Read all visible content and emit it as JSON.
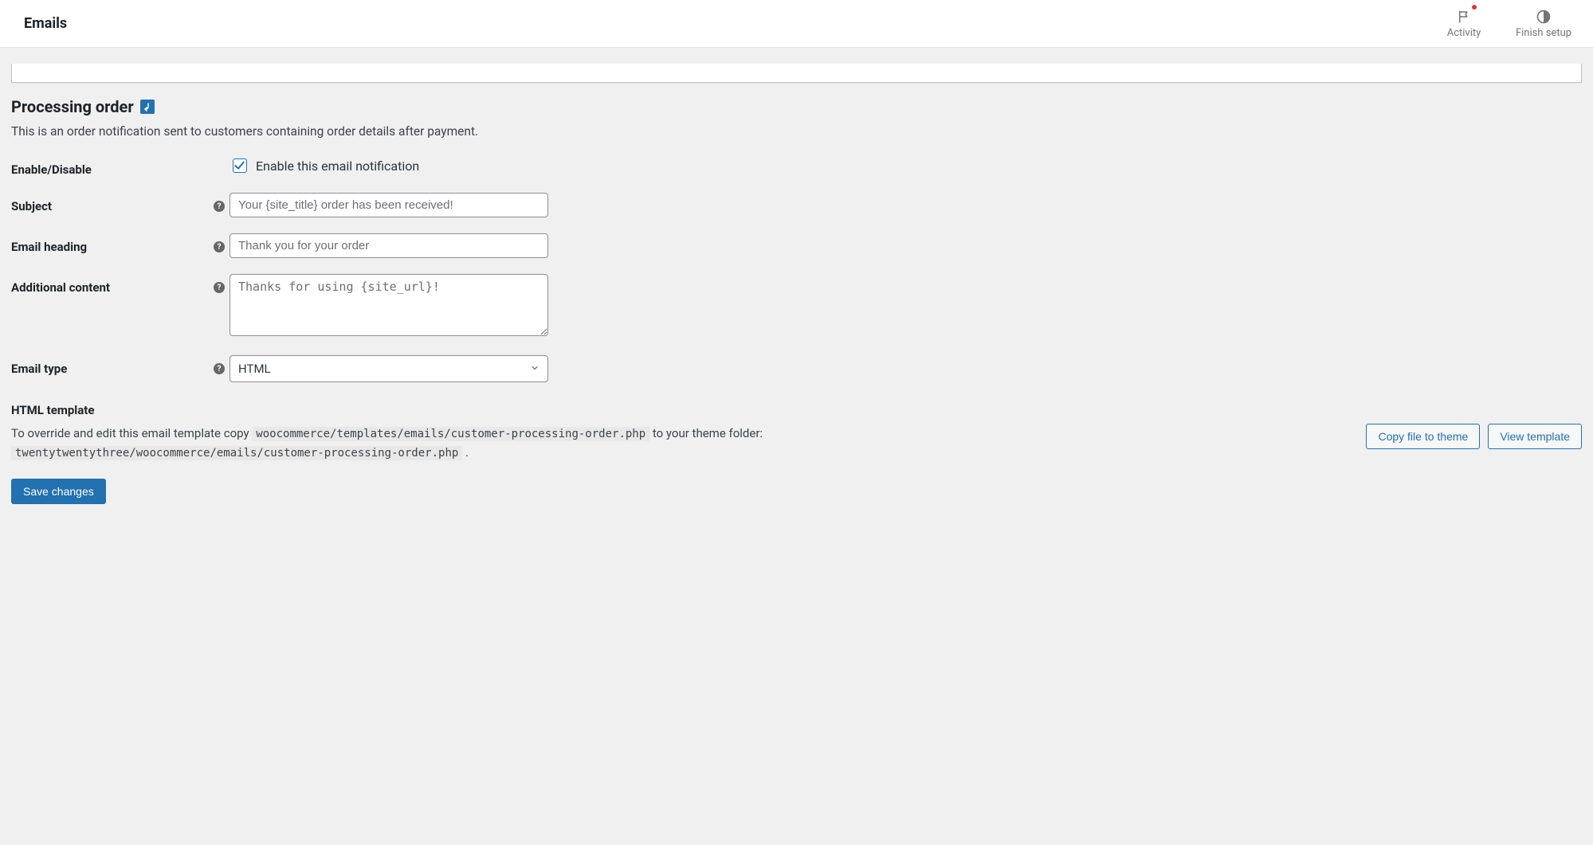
{
  "topbar": {
    "title": "Emails",
    "activity_label": "Activity",
    "finish_setup_label": "Finish setup"
  },
  "section": {
    "title": "Processing order",
    "description": "This is an order notification sent to customers containing order details after payment."
  },
  "form": {
    "enable": {
      "label": "Enable/Disable",
      "checkbox_label": "Enable this email notification",
      "checked": true
    },
    "subject": {
      "label": "Subject",
      "placeholder": "Your {site_title} order has been received!",
      "value": ""
    },
    "heading": {
      "label": "Email heading",
      "placeholder": "Thank you for your order",
      "value": ""
    },
    "additional": {
      "label": "Additional content",
      "placeholder": "Thanks for using {site_url}!",
      "value": ""
    },
    "type": {
      "label": "Email type",
      "selected": "HTML"
    }
  },
  "template": {
    "heading": "HTML template",
    "pre_text": "To override and edit this email template copy ",
    "source_path": "woocommerce/templates/emails/customer-processing-order.php",
    "mid_text": " to your theme folder: ",
    "dest_path": "twentytwentythree/woocommerce/emails/customer-processing-order.php",
    "post_text": " .",
    "copy_label": "Copy file to theme",
    "view_label": "View template"
  },
  "save_label": "Save changes"
}
